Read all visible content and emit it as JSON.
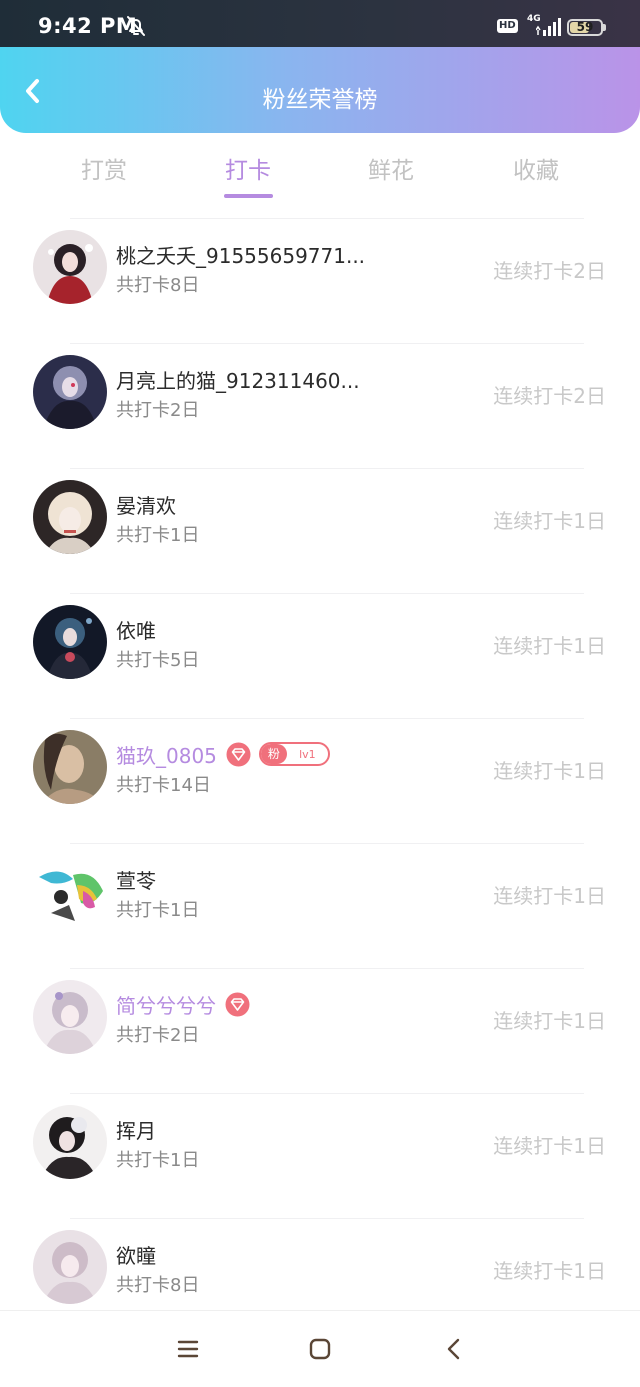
{
  "status_bar": {
    "time": "9:42 PM",
    "hd": "HD",
    "network": "4G",
    "battery_level": "59",
    "battery_fraction": 0.59
  },
  "header": {
    "title": "粉丝荣誉榜",
    "back_icon": "chevron-left-icon"
  },
  "tabs": [
    {
      "label": "打赏",
      "active": false
    },
    {
      "label": "打卡",
      "active": true
    },
    {
      "label": "鲜花",
      "active": false
    },
    {
      "label": "收藏",
      "active": false
    }
  ],
  "list": [
    {
      "name": "桃之夭夭_91555659771...",
      "total": "共打卡8日",
      "streak": "连续打卡2日",
      "vip": false,
      "diamond": false,
      "fan_badge": false
    },
    {
      "name": "月亮上的猫_912311460...",
      "total": "共打卡2日",
      "streak": "连续打卡2日",
      "vip": false,
      "diamond": false,
      "fan_badge": false
    },
    {
      "name": "晏清欢",
      "total": "共打卡1日",
      "streak": "连续打卡1日",
      "vip": false,
      "diamond": false,
      "fan_badge": false
    },
    {
      "name": "依唯",
      "total": "共打卡5日",
      "streak": "连续打卡1日",
      "vip": false,
      "diamond": false,
      "fan_badge": false
    },
    {
      "name": "猫玖_0805",
      "total": "共打卡14日",
      "streak": "连续打卡1日",
      "vip": true,
      "diamond": true,
      "fan_badge": true,
      "fan_badge_label": "粉",
      "fan_badge_level": "lv1"
    },
    {
      "name": "萱苓",
      "total": "共打卡1日",
      "streak": "连续打卡1日",
      "vip": false,
      "diamond": false,
      "fan_badge": false
    },
    {
      "name": "简兮兮兮兮",
      "total": "共打卡2日",
      "streak": "连续打卡1日",
      "vip": true,
      "diamond": true,
      "fan_badge": false
    },
    {
      "name": "挥月",
      "total": "共打卡1日",
      "streak": "连续打卡1日",
      "vip": false,
      "diamond": false,
      "fan_badge": false
    },
    {
      "name": "欲瞳",
      "total": "共打卡8日",
      "streak": "连续打卡1日",
      "vip": false,
      "diamond": false,
      "fan_badge": false
    }
  ],
  "nav": {
    "menu_icon": "menu-icon",
    "home_icon": "home-icon",
    "back_icon": "back-icon"
  },
  "colors": {
    "accent": "#b58be0",
    "header_gradient_start": "#4fd4f0",
    "header_gradient_end": "#ba93e8",
    "fan_badge": "#f0707c",
    "diamond": "#f0707c"
  }
}
